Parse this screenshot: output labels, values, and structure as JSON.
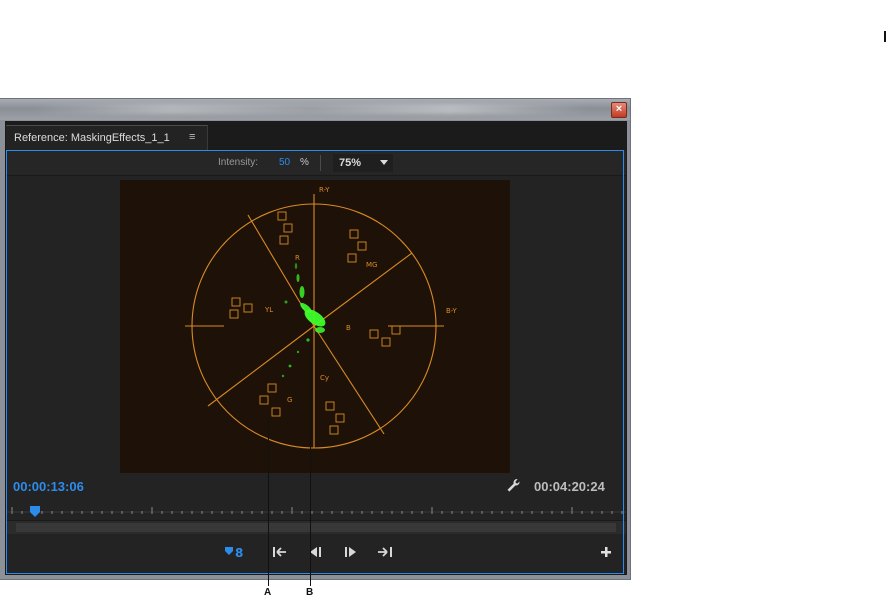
{
  "window": {
    "close_glyph": "×"
  },
  "panel": {
    "tab_label": "Reference: MaskingEffects_1_1",
    "tab_menu_glyph": "≡"
  },
  "toolbar": {
    "intensity_label": "Intensity:",
    "intensity_value": "50",
    "intensity_unit": "%",
    "zoom_value": "75%"
  },
  "scope": {
    "axis_labels": {
      "ry": "R-Y",
      "by": "B-Y"
    },
    "sector_labels": [
      "R",
      "MG",
      "B",
      "Cy",
      "G",
      "YL"
    ],
    "graticule_color": "#d98a25",
    "trace_color": "#3dff2a"
  },
  "timecodes": {
    "current": "00:00:13:06",
    "duration": "00:04:20:24"
  },
  "icons": {
    "wrench": "wrench-icon",
    "marker": "marker-link-icon",
    "step_back": "go-to-in-icon",
    "frame_back": "step-back-icon",
    "frame_fwd": "step-forward-icon",
    "step_fwd": "go-to-out-icon",
    "add": "add-button-icon"
  },
  "colors": {
    "accent": "#2d8ceb"
  },
  "callouts": [
    {
      "letter": "A"
    },
    {
      "letter": "B"
    }
  ]
}
